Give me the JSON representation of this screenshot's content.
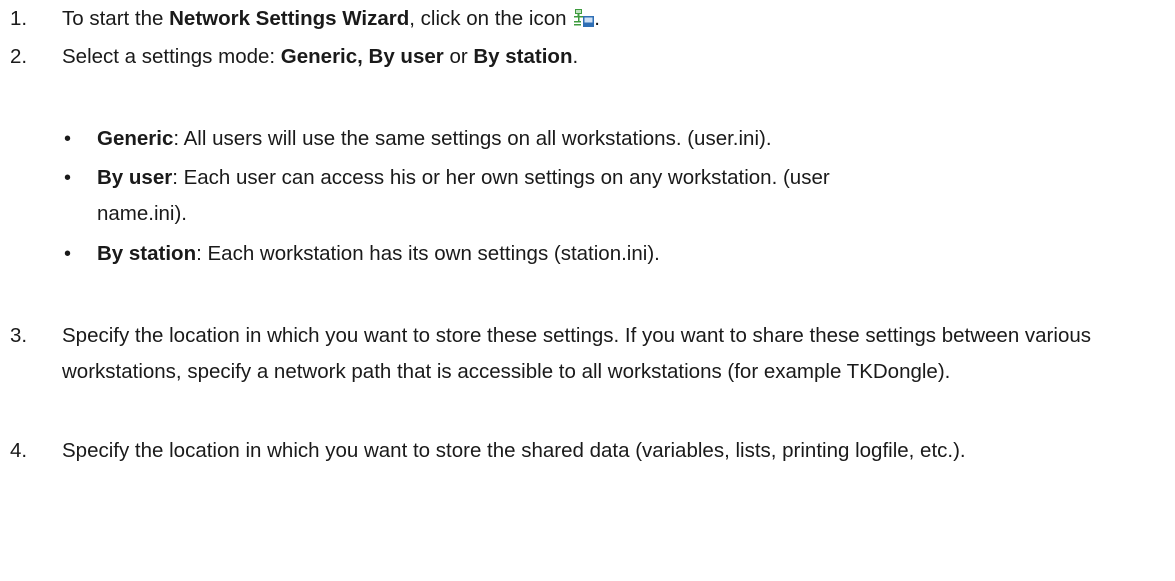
{
  "steps": [
    {
      "num": "1.",
      "pre": "To start the ",
      "bold": "Network Settings Wizard",
      "post": ", click on the icon ",
      "icon": "network-settings-icon",
      "tail": "."
    },
    {
      "num": "2.",
      "pre": "Select a settings mode: ",
      "bold": "Generic, By user",
      "mid": " or ",
      "bold2": "By station",
      "tail": "."
    },
    {
      "num": "3.",
      "text": "Specify the location in which you want to store these settings. If you want to share these settings between various workstations, specify a network path that is accessible to all workstations (for example TKDongle)."
    },
    {
      "num": "4.",
      "text": "Specify the location in which you want to store the shared data (variables, lists, printing logfile, etc.)."
    }
  ],
  "modes": [
    {
      "name": "Generic",
      "desc": ": All users will use the same settings on all workstations. (user.ini)."
    },
    {
      "name": "By user",
      "desc": ": Each user can access his or her own settings on any workstation. (user name.ini)."
    },
    {
      "name": "By station",
      "desc": ": Each workstation has its own settings (station.ini)."
    }
  ],
  "bullet_char": "•",
  "colors": {
    "text": "#1a1a1a",
    "icon_green": "#3e9b3e",
    "icon_blue": "#2f6fb5"
  }
}
